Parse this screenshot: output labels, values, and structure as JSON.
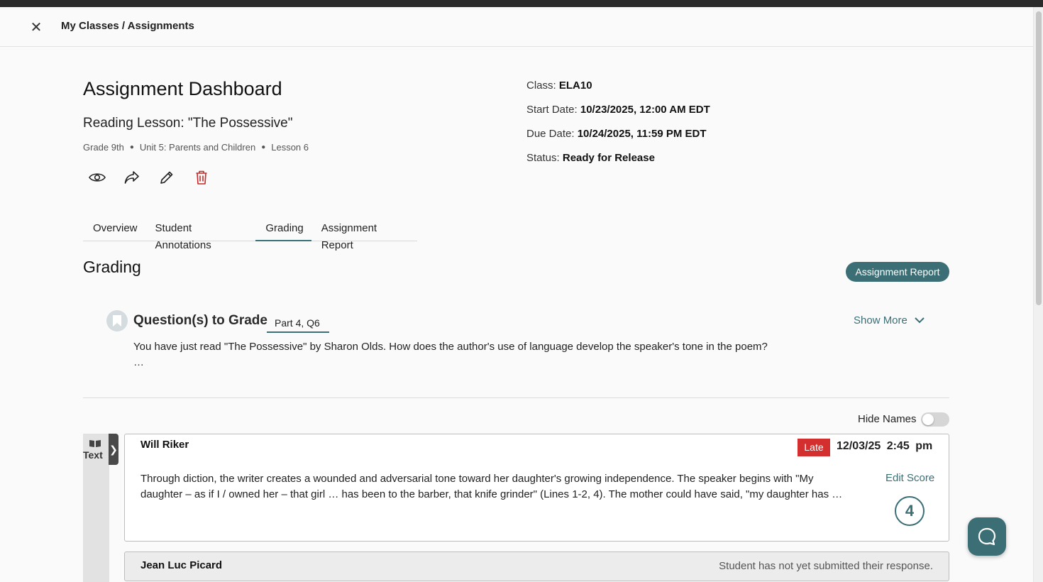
{
  "header": {
    "breadcrumb": "My Classes / Assignments"
  },
  "dashboard": {
    "title": "Assignment Dashboard",
    "lesson_title": "Reading Lesson: \"The Possessive\"",
    "meta": {
      "grade": "Grade 9th",
      "unit": "Unit 5: Parents and Children",
      "lesson": "Lesson 6"
    },
    "actions": [
      "eye-icon",
      "share-icon",
      "pencil-icon",
      "trash-icon"
    ]
  },
  "info": {
    "class_label": "Class:",
    "class_value": "ELA10",
    "start_label": "Start Date:",
    "start_value": "10/23/2025, 12:00 AM EDT",
    "due_label": "Due Date:",
    "due_value": "10/24/2025, 11:59 PM EDT",
    "status_label": "Status:",
    "status_value": "Ready for Release"
  },
  "tabs": [
    {
      "label": "Overview"
    },
    {
      "label": "Student Annotations"
    },
    {
      "label": "Grading"
    },
    {
      "label": "Assignment Report"
    }
  ],
  "grading": {
    "title": "Grading",
    "report_button": "Assignment Report",
    "question_heading": "Question(s) to Grade",
    "question_part": "Part 4, Q6",
    "show_more": "Show More",
    "question_text": "You have just read \"The Possessive\" by Sharon Olds. How does the author's use of language develop the speaker's tone in the poem?",
    "question_ellipsis": "…",
    "hide_names_label": "Hide Names"
  },
  "side_panel": {
    "label": "Text"
  },
  "responses": [
    {
      "student": "Will Riker",
      "late_badge": "Late",
      "submitted": "12/03/25  2:45 pm",
      "text": "Through diction, the writer creates a wounded and adversarial tone toward her daughter's growing independence. The speaker begins with \"My daughter – as if I / owned her – that girl … has been to the barber, that knife grinder\" (Lines 1-2, 4). The mother could have  said, \"my daughter has …",
      "edit_label": "Edit Score",
      "score": "4"
    },
    {
      "student": "Jean Luc Picard",
      "status": "Student has not yet submitted their response."
    }
  ],
  "colors": {
    "accent": "#3b6f75",
    "late": "#d32f2f",
    "delete": "#c62828"
  }
}
